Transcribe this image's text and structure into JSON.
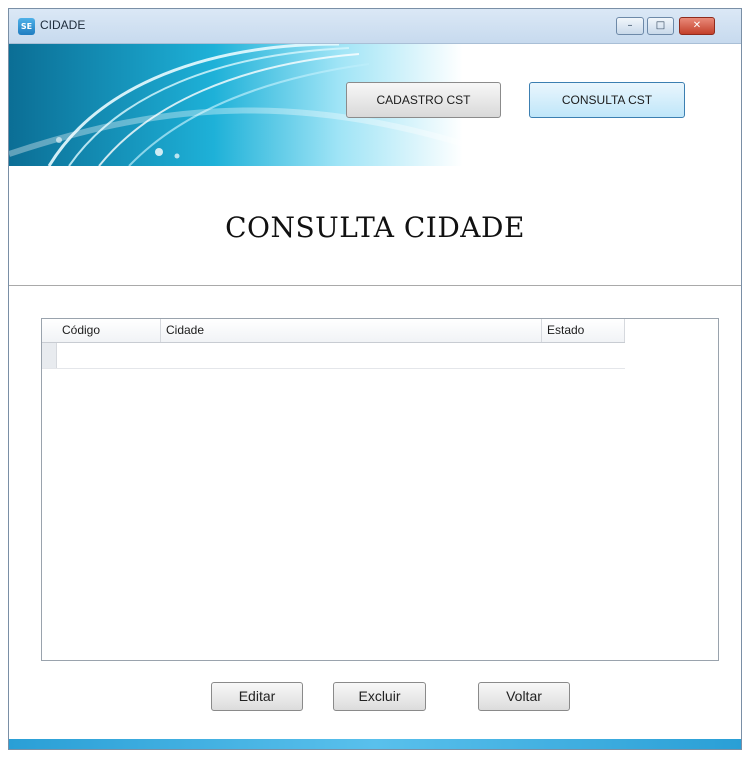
{
  "window": {
    "title": "CIDADE",
    "app_icon_text": "SE",
    "controls": {
      "minimize": "–",
      "maximize": "□",
      "close": "✕"
    }
  },
  "header": {
    "nav": {
      "cadastro_label": "CADASTRO CST",
      "consulta_label": "CONSULTA CST"
    }
  },
  "page": {
    "title": "CONSULTA CIDADE"
  },
  "grid": {
    "columns": [
      "Código",
      "Cidade",
      "Estado"
    ],
    "rows": [
      [
        "",
        "",
        ""
      ]
    ]
  },
  "actions": {
    "editar": "Editar",
    "excluir": "Excluir",
    "voltar": "Voltar"
  },
  "colors": {
    "banner_dark": "#0b6e95",
    "banner_light": "#1eb1d8",
    "selected_button": "#bfe6f9"
  }
}
